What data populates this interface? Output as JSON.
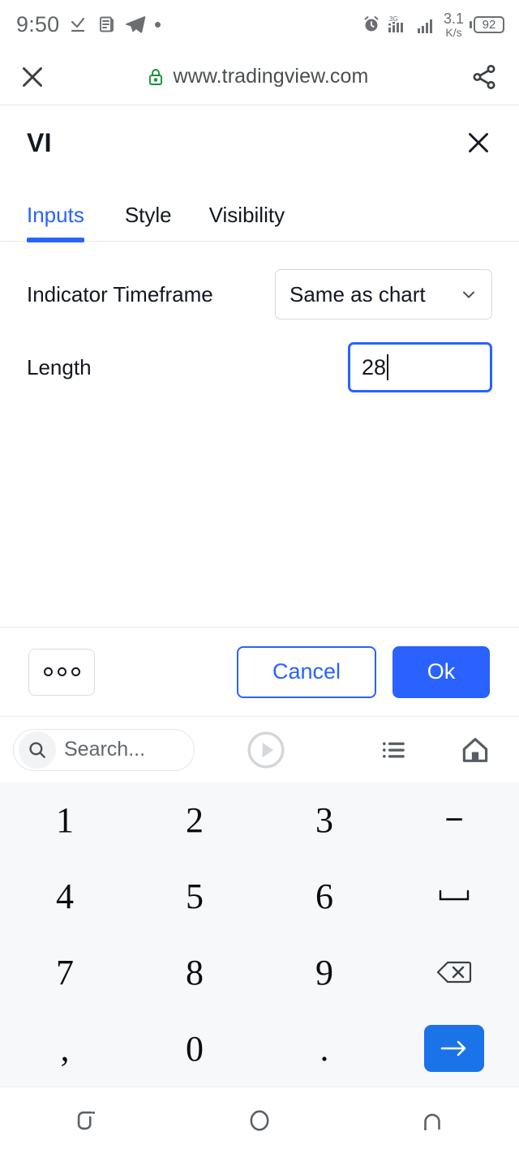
{
  "statusbar": {
    "time": "9:50",
    "icons_left": [
      "download-check-icon",
      "news-document-icon",
      "telegram-icon",
      "dot-icon"
    ],
    "alarm": "alarm-icon",
    "network_type": "3G",
    "net_speed_value": "3.1",
    "net_speed_unit": "K/s",
    "battery_percent": "92"
  },
  "browser": {
    "close_label": "close-icon",
    "lock_icon": "lock-icon",
    "url": "www.tradingview.com",
    "share_icon": "share-icon",
    "lock_color": "#1a8f3c"
  },
  "dialog": {
    "title": "VI",
    "close_icon": "close-icon",
    "tabs": [
      {
        "label": "Inputs",
        "active": true
      },
      {
        "label": "Style",
        "active": false
      },
      {
        "label": "Visibility",
        "active": false
      }
    ],
    "fields": [
      {
        "label": "Indicator Timeframe",
        "type": "select",
        "value": "Same as chart",
        "chevron": "chevron-down-icon"
      },
      {
        "label": "Length",
        "type": "number",
        "value": "28",
        "focused": true
      }
    ],
    "footer": {
      "more_label": "ooo",
      "cancel_label": "Cancel",
      "ok_label": "Ok"
    },
    "accent_color": "#2962ff"
  },
  "keyboard_toolbar": {
    "search_placeholder": "Search...",
    "search_icon": "search-icon",
    "play_icon": "play-circle-icon",
    "list_icon": "list-icon",
    "home_icon": "home-icon"
  },
  "keypad": {
    "keys": [
      {
        "label": "1",
        "name": "key-1",
        "kind": "digit"
      },
      {
        "label": "2",
        "name": "key-2",
        "kind": "digit"
      },
      {
        "label": "3",
        "name": "key-3",
        "kind": "digit"
      },
      {
        "label": "−",
        "name": "key-minus",
        "kind": "symbol"
      },
      {
        "label": "4",
        "name": "key-4",
        "kind": "digit"
      },
      {
        "label": "5",
        "name": "key-5",
        "kind": "digit"
      },
      {
        "label": "6",
        "name": "key-6",
        "kind": "digit"
      },
      {
        "label": "⌴",
        "name": "key-space",
        "kind": "space"
      },
      {
        "label": "7",
        "name": "key-7",
        "kind": "digit"
      },
      {
        "label": "8",
        "name": "key-8",
        "kind": "digit"
      },
      {
        "label": "9",
        "name": "key-9",
        "kind": "digit"
      },
      {
        "label": "",
        "name": "key-backspace",
        "kind": "backspace"
      },
      {
        "label": ",",
        "name": "key-comma",
        "kind": "symbol"
      },
      {
        "label": "0",
        "name": "key-0",
        "kind": "digit"
      },
      {
        "label": ".",
        "name": "key-period",
        "kind": "symbol"
      },
      {
        "label": "",
        "name": "key-enter",
        "kind": "enter"
      }
    ],
    "enter_color": "#1a73e8",
    "background": "#f6f8fa"
  },
  "navbar": {
    "recents_icon": "recents-icon",
    "home_icon": "home-circle-icon",
    "back_icon": "back-arc-icon"
  }
}
